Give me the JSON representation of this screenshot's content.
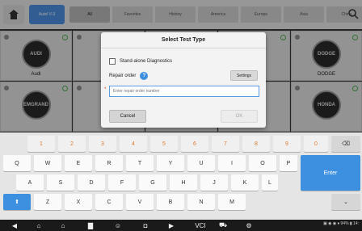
{
  "topbar": {
    "brand_label": "Autel\nV-3",
    "tabs": [
      "All",
      "Favorites",
      "History",
      "America",
      "Europe",
      "Asia",
      "China"
    ]
  },
  "tiles": [
    {
      "logo": "AUDI",
      "label": "Audi"
    },
    {
      "logo": "",
      "label": ""
    },
    {
      "logo": "",
      "label": ""
    },
    {
      "logo": "",
      "label": ""
    },
    {
      "logo": "DODGE",
      "label": "DODGE"
    },
    {
      "logo": "EMGRAND",
      "label": ""
    },
    {
      "logo": "",
      "label": ""
    },
    {
      "logo": "",
      "label": ""
    },
    {
      "logo": "",
      "label": ""
    },
    {
      "logo": "HONDA",
      "label": ""
    }
  ],
  "dialog": {
    "title": "Select Test Type",
    "standalone_label": "Stand-alone Diagnostics",
    "repair_label": "Repair order",
    "help": "?",
    "settings_label": "Settings",
    "required_mark": "*",
    "input_placeholder": "Enter repair order number",
    "cancel_label": "Cancel",
    "ok_label": "OK"
  },
  "keyboard": {
    "row1": [
      "1",
      "2",
      "3",
      "4",
      "5",
      "6",
      "7",
      "8",
      "9",
      "0"
    ],
    "row2": [
      "Q",
      "W",
      "E",
      "R",
      "T",
      "Y",
      "U",
      "I",
      "O",
      "P"
    ],
    "row3": [
      "A",
      "S",
      "D",
      "F",
      "G",
      "H",
      "J",
      "K",
      "L",
      "+",
      "-"
    ],
    "row4": [
      "Z",
      "X",
      "C",
      "V",
      "B",
      "N",
      "M"
    ],
    "enter_label": "Enter",
    "backspace": "⌫",
    "shift": "⬆",
    "hide": "⌄"
  },
  "navbar": {
    "items": [
      "◀",
      "⌂",
      "⌂",
      "▇",
      "☺",
      "◘",
      "▶",
      "VCI",
      "⛟",
      "⚙"
    ],
    "status": "▣ ◉ ◉ ♦ 94% ▮ 14:"
  },
  "colors": {
    "accent": "#3d8fe0",
    "number_keys": "#e07a2e"
  }
}
